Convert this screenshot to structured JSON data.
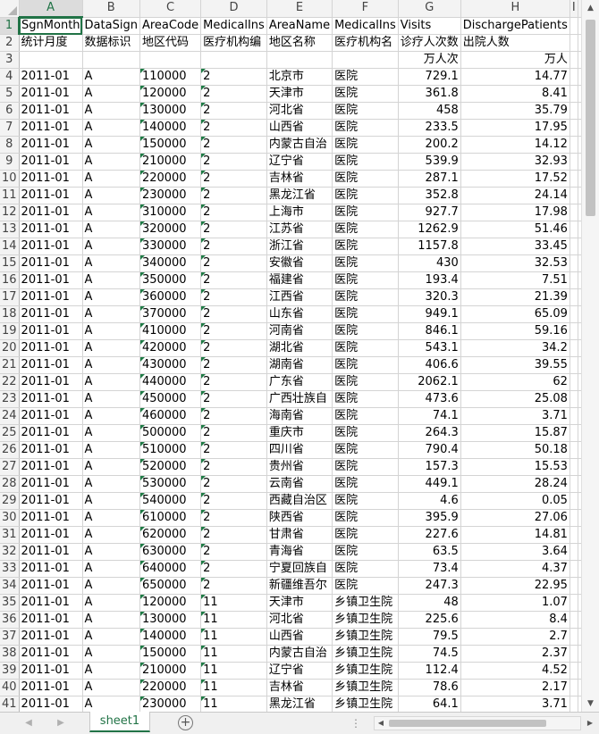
{
  "columns": [
    "A",
    "B",
    "C",
    "D",
    "E",
    "F",
    "G",
    "H",
    "I"
  ],
  "rows": [
    [
      "SgnMonth",
      "DataSign",
      "AreaCode",
      "MedicalIns",
      "AreaName",
      "MedicalIns",
      "Visits",
      "DischargePatients",
      ""
    ],
    [
      "统计月度",
      "数据标识",
      "地区代码",
      "医疗机构编",
      "地区名称",
      "医疗机构名",
      "诊疗人次数",
      "出院人数",
      ""
    ],
    [
      "",
      "",
      "",
      "",
      "",
      "",
      "万人次",
      "万人",
      ""
    ],
    [
      "2011-01",
      "A",
      "110000",
      "2",
      "北京市",
      "医院",
      "729.1",
      "14.77",
      ""
    ],
    [
      "2011-01",
      "A",
      "120000",
      "2",
      "天津市",
      "医院",
      "361.8",
      "8.41",
      ""
    ],
    [
      "2011-01",
      "A",
      "130000",
      "2",
      "河北省",
      "医院",
      "458",
      "35.79",
      ""
    ],
    [
      "2011-01",
      "A",
      "140000",
      "2",
      "山西省",
      "医院",
      "233.5",
      "17.95",
      ""
    ],
    [
      "2011-01",
      "A",
      "150000",
      "2",
      "内蒙古自治",
      "医院",
      "200.2",
      "14.12",
      ""
    ],
    [
      "2011-01",
      "A",
      "210000",
      "2",
      "辽宁省",
      "医院",
      "539.9",
      "32.93",
      ""
    ],
    [
      "2011-01",
      "A",
      "220000",
      "2",
      "吉林省",
      "医院",
      "287.1",
      "17.52",
      ""
    ],
    [
      "2011-01",
      "A",
      "230000",
      "2",
      "黑龙江省",
      "医院",
      "352.8",
      "24.14",
      ""
    ],
    [
      "2011-01",
      "A",
      "310000",
      "2",
      "上海市",
      "医院",
      "927.7",
      "17.98",
      ""
    ],
    [
      "2011-01",
      "A",
      "320000",
      "2",
      "江苏省",
      "医院",
      "1262.9",
      "51.46",
      ""
    ],
    [
      "2011-01",
      "A",
      "330000",
      "2",
      "浙江省",
      "医院",
      "1157.8",
      "33.45",
      ""
    ],
    [
      "2011-01",
      "A",
      "340000",
      "2",
      "安徽省",
      "医院",
      "430",
      "32.53",
      ""
    ],
    [
      "2011-01",
      "A",
      "350000",
      "2",
      "福建省",
      "医院",
      "193.4",
      "7.51",
      ""
    ],
    [
      "2011-01",
      "A",
      "360000",
      "2",
      "江西省",
      "医院",
      "320.3",
      "21.39",
      ""
    ],
    [
      "2011-01",
      "A",
      "370000",
      "2",
      "山东省",
      "医院",
      "949.1",
      "65.09",
      ""
    ],
    [
      "2011-01",
      "A",
      "410000",
      "2",
      "河南省",
      "医院",
      "846.1",
      "59.16",
      ""
    ],
    [
      "2011-01",
      "A",
      "420000",
      "2",
      "湖北省",
      "医院",
      "543.1",
      "34.2",
      ""
    ],
    [
      "2011-01",
      "A",
      "430000",
      "2",
      "湖南省",
      "医院",
      "406.6",
      "39.55",
      ""
    ],
    [
      "2011-01",
      "A",
      "440000",
      "2",
      "广东省",
      "医院",
      "2062.1",
      "62",
      ""
    ],
    [
      "2011-01",
      "A",
      "450000",
      "2",
      "广西壮族自",
      "医院",
      "473.6",
      "25.08",
      ""
    ],
    [
      "2011-01",
      "A",
      "460000",
      "2",
      "海南省",
      "医院",
      "74.1",
      "3.71",
      ""
    ],
    [
      "2011-01",
      "A",
      "500000",
      "2",
      "重庆市",
      "医院",
      "264.3",
      "15.87",
      ""
    ],
    [
      "2011-01",
      "A",
      "510000",
      "2",
      "四川省",
      "医院",
      "790.4",
      "50.18",
      ""
    ],
    [
      "2011-01",
      "A",
      "520000",
      "2",
      "贵州省",
      "医院",
      "157.3",
      "15.53",
      ""
    ],
    [
      "2011-01",
      "A",
      "530000",
      "2",
      "云南省",
      "医院",
      "449.1",
      "28.24",
      ""
    ],
    [
      "2011-01",
      "A",
      "540000",
      "2",
      "西藏自治区",
      "医院",
      "4.6",
      "0.05",
      ""
    ],
    [
      "2011-01",
      "A",
      "610000",
      "2",
      "陕西省",
      "医院",
      "395.9",
      "27.06",
      ""
    ],
    [
      "2011-01",
      "A",
      "620000",
      "2",
      "甘肃省",
      "医院",
      "227.6",
      "14.81",
      ""
    ],
    [
      "2011-01",
      "A",
      "630000",
      "2",
      "青海省",
      "医院",
      "63.5",
      "3.64",
      ""
    ],
    [
      "2011-01",
      "A",
      "640000",
      "2",
      "宁夏回族自",
      "医院",
      "73.4",
      "4.37",
      ""
    ],
    [
      "2011-01",
      "A",
      "650000",
      "2",
      "新疆维吾尔",
      "医院",
      "247.3",
      "22.95",
      ""
    ],
    [
      "2011-01",
      "A",
      "120000",
      "11",
      "天津市",
      "乡镇卫生院",
      "48",
      "1.07",
      ""
    ],
    [
      "2011-01",
      "A",
      "130000",
      "11",
      "河北省",
      "乡镇卫生院",
      "225.6",
      "8.4",
      ""
    ],
    [
      "2011-01",
      "A",
      "140000",
      "11",
      "山西省",
      "乡镇卫生院",
      "79.5",
      "2.7",
      ""
    ],
    [
      "2011-01",
      "A",
      "150000",
      "11",
      "内蒙古自治",
      "乡镇卫生院",
      "74.5",
      "2.37",
      ""
    ],
    [
      "2011-01",
      "A",
      "210000",
      "11",
      "辽宁省",
      "乡镇卫生院",
      "112.4",
      "4.52",
      ""
    ],
    [
      "2011-01",
      "A",
      "220000",
      "11",
      "吉林省",
      "乡镇卫生院",
      "78.6",
      "2.17",
      ""
    ],
    [
      "2011-01",
      "A",
      "230000",
      "11",
      "黑龙江省",
      "乡镇卫生院",
      "64.1",
      "3.71",
      ""
    ]
  ],
  "sheet_tab": "sheet1",
  "add_sheet": "⊕",
  "tab_more": "⋮",
  "colors": {
    "accent": "#217346",
    "header_bg": "#f3f3f3",
    "grid": "#d4d4d4"
  }
}
